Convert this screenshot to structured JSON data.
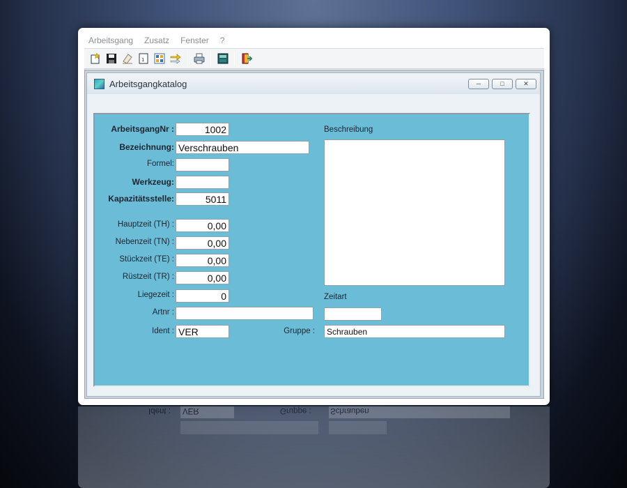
{
  "menu": [
    "Arbeitsgang",
    "Zusatz",
    "Fenster",
    "?"
  ],
  "toolbar_icons": [
    "new-record-icon",
    "save-disk-icon",
    "eraser-icon",
    "report-document-icon",
    "grid-select-icon",
    "transfer-arrows-icon",
    "print-icon",
    "calculator-icon",
    "exit-door-icon"
  ],
  "child_window": {
    "title": "Arbeitsgangkatalog"
  },
  "form": {
    "arbeitsgangnr_label": "ArbeitsgangNr :",
    "arbeitsgangnr": "1002",
    "bezeichnung_label": "Bezeichnung:",
    "bezeichnung": "Verschrauben",
    "formel_label": "Formel:",
    "formel": "",
    "werkzeug_label": "Werkzeug:",
    "werkzeug": "",
    "kapazitaet_label": "Kapazitätsstelle:",
    "kapazitaet": "5011",
    "hauptzeit_label": "Hauptzeit (TH) :",
    "hauptzeit": "0,00",
    "nebenzeit_label": "Nebenzeit (TN) :",
    "nebenzeit": "0,00",
    "stueckzeit_label": "Stückzeit (TE) :",
    "stueckzeit": "0,00",
    "ruestzeit_label": "Rüstzeit (TR) :",
    "ruestzeit": "0,00",
    "liegezeit_label": "Liegezeit  :",
    "liegezeit": "0",
    "artnr_label": "Artnr  :",
    "artnr": "",
    "ident_label": "Ident  :",
    "ident": "VER",
    "beschreibung_label": "Beschreibung",
    "beschreibung": "",
    "zeitart_label": "Zeitart",
    "zeitart": "",
    "gruppe_label": "Gruppe  :",
    "gruppe": "Schrauben"
  },
  "colors": {
    "panel": "#6bbcd7",
    "desktop": "#3e5075"
  }
}
